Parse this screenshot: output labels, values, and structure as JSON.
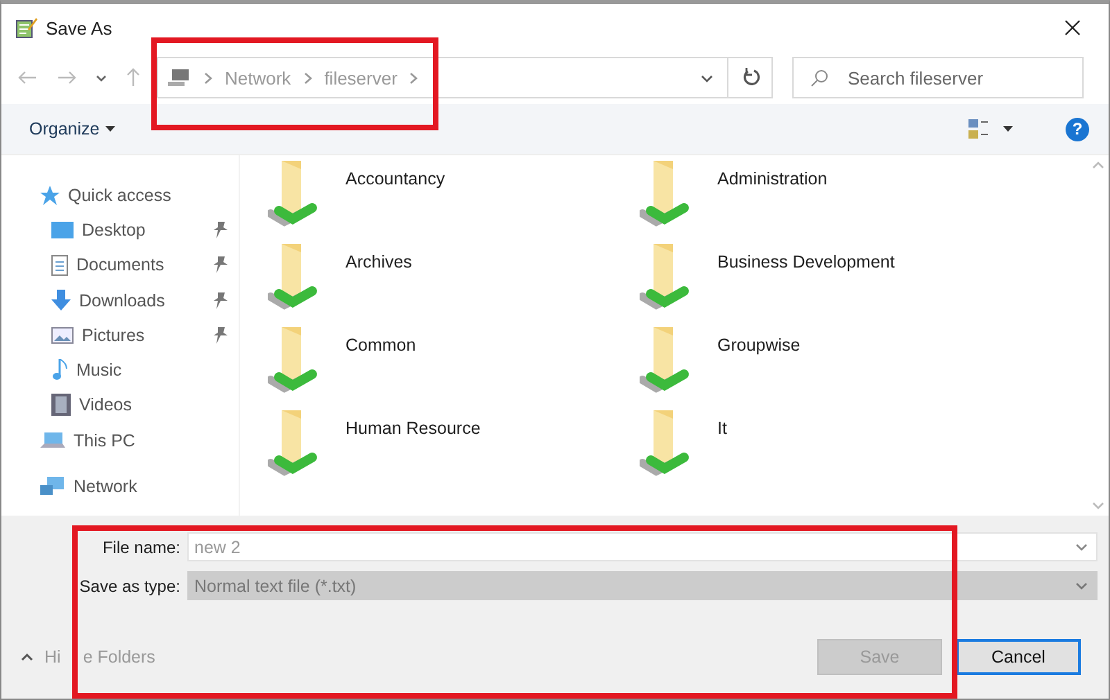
{
  "window": {
    "title": "Save As"
  },
  "address_bar": {
    "breadcrumbs": [
      "Network",
      "fileserver"
    ]
  },
  "search": {
    "placeholder": "Search fileserver"
  },
  "toolbar": {
    "organize": "Organize",
    "help": "?"
  },
  "sidebar": {
    "items": [
      {
        "label": "Quick access",
        "kind": "star",
        "children": [
          {
            "label": "Desktop",
            "kind": "desktop",
            "pinned": true
          },
          {
            "label": "Documents",
            "kind": "documents",
            "pinned": true
          },
          {
            "label": "Downloads",
            "kind": "downloads",
            "pinned": true
          },
          {
            "label": "Pictures",
            "kind": "pictures",
            "pinned": true
          },
          {
            "label": "Music",
            "kind": "music",
            "pinned": false
          },
          {
            "label": "Videos",
            "kind": "videos",
            "pinned": false
          }
        ]
      },
      {
        "label": "This PC",
        "kind": "pc"
      },
      {
        "label": "Network",
        "kind": "network"
      }
    ]
  },
  "folders": [
    {
      "name": "Accountancy"
    },
    {
      "name": "Administration"
    },
    {
      "name": "Archives"
    },
    {
      "name": "Business Development"
    },
    {
      "name": "Common"
    },
    {
      "name": "Groupwise"
    },
    {
      "name": "Human Resource"
    },
    {
      "name": "It"
    }
  ],
  "form": {
    "file_name_label": "File name:",
    "file_name": "new 2",
    "type_label": "Save as type:",
    "type_value": "Normal text file (*.txt)",
    "type_disabled": true
  },
  "footer": {
    "hide_folders_parts": [
      "Hi",
      "e Folders"
    ]
  },
  "buttons": [
    {
      "label": "Save",
      "disabled": true
    },
    {
      "label": "Cancel",
      "disabled": false
    }
  ]
}
